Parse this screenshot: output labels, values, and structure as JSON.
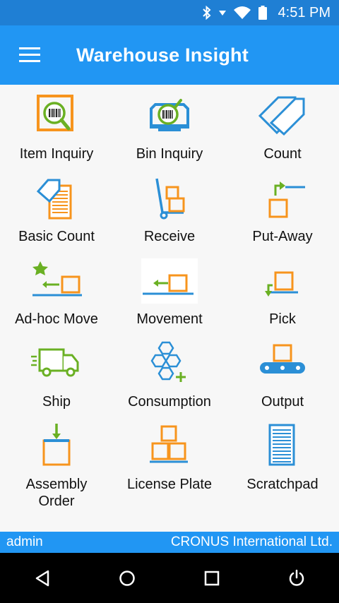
{
  "status_bar": {
    "time": "4:51 PM",
    "icons": [
      "bluetooth-icon",
      "signal-icon",
      "wifi-icon",
      "battery-icon"
    ]
  },
  "app_bar": {
    "menu_icon": "hamburger-menu-icon",
    "title": "Warehouse Insight"
  },
  "tiles": [
    {
      "label": "Item Inquiry",
      "icon": "item-inquiry-icon"
    },
    {
      "label": "Bin Inquiry",
      "icon": "bin-inquiry-icon"
    },
    {
      "label": "Count",
      "icon": "count-tags-icon"
    },
    {
      "label": "Basic Count",
      "icon": "basic-count-icon"
    },
    {
      "label": "Receive",
      "icon": "hand-truck-icon"
    },
    {
      "label": "Put-Away",
      "icon": "put-away-icon"
    },
    {
      "label": "Ad-hoc Move",
      "icon": "adhoc-move-icon"
    },
    {
      "label": "Movement",
      "icon": "movement-icon"
    },
    {
      "label": "Pick",
      "icon": "pick-icon"
    },
    {
      "label": "Ship",
      "icon": "truck-icon"
    },
    {
      "label": "Consumption",
      "icon": "consumption-icon"
    },
    {
      "label": "Output",
      "icon": "conveyor-icon"
    },
    {
      "label": "Assembly\nOrder",
      "icon": "assembly-order-icon"
    },
    {
      "label": "License Plate",
      "icon": "license-plate-icon"
    },
    {
      "label": "Scratchpad",
      "icon": "scratchpad-icon"
    }
  ],
  "footer": {
    "user": "admin",
    "company": "CRONUS International Ltd."
  },
  "nav_bar": {
    "buttons": [
      "back-icon",
      "home-icon",
      "recents-icon",
      "power-icon"
    ]
  },
  "colors": {
    "primary": "#2196f3",
    "status_bar": "#1f7fd4",
    "icon_orange": "#f7941d",
    "icon_blue": "#2b8fd6",
    "icon_green": "#6ab023"
  }
}
